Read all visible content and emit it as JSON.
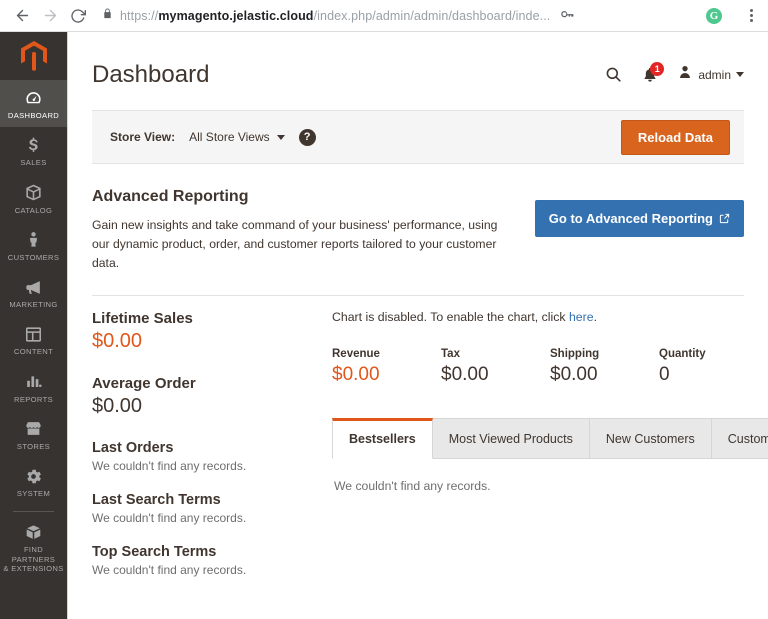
{
  "browser": {
    "back_icon": "arrow-left-icon",
    "forward_icon": "arrow-right-icon",
    "reload_icon": "reload-icon",
    "lock_icon": "lock-icon",
    "url_scheme": "https://",
    "url_domain": "mymagento.jelastic.cloud",
    "url_path": "/index.php/admin/admin/dashboard/inde...",
    "key_icon": "key-icon",
    "extension_icon": "extension-icon",
    "extension_glyph": "G",
    "menu_icon": "kebab-menu-icon"
  },
  "sidebar": {
    "logo": "magento-logo",
    "items": [
      {
        "label": "Dashboard",
        "icon": "gauge-icon",
        "active": true
      },
      {
        "label": "Sales",
        "icon": "dollar-icon",
        "active": false
      },
      {
        "label": "Catalog",
        "icon": "box-icon",
        "active": false
      },
      {
        "label": "Customers",
        "icon": "person-icon",
        "active": false
      },
      {
        "label": "Marketing",
        "icon": "megaphone-icon",
        "active": false
      },
      {
        "label": "Content",
        "icon": "layout-icon",
        "active": false
      },
      {
        "label": "Reports",
        "icon": "bar-chart-icon",
        "active": false
      },
      {
        "label": "Stores",
        "icon": "storefront-icon",
        "active": false
      },
      {
        "label": "System",
        "icon": "gear-icon",
        "active": false
      }
    ],
    "footer_item": {
      "label": "Find Partners\n& Extensions",
      "label_line1": "Find Partners",
      "label_line2": "& Extensions",
      "icon": "extension-block-icon"
    }
  },
  "header": {
    "title": "Dashboard",
    "search_icon": "search-icon",
    "notification_icon": "bell-icon",
    "notification_count": "1",
    "avatar_icon": "user-icon",
    "admin_label": "admin",
    "caret_icon": "chevron-down-icon"
  },
  "storeview": {
    "label": "Store View:",
    "selected": "All Store Views",
    "caret_icon": "chevron-down-icon",
    "help_icon": "question-mark-icon",
    "help_glyph": "?",
    "reload_label": "Reload Data"
  },
  "advanced_reporting": {
    "title": "Advanced Reporting",
    "description": "Gain new insights and take command of your business' performance, using our dynamic product, order, and customer reports tailored to your customer data.",
    "button_label": "Go to Advanced Reporting",
    "button_icon": "external-link-icon"
  },
  "stats": {
    "lifetime_sales": {
      "title": "Lifetime Sales",
      "value": "$0.00"
    },
    "average_order": {
      "title": "Average Order",
      "value": "$0.00"
    },
    "lists": [
      {
        "title": "Last Orders",
        "empty": "We couldn't find any records."
      },
      {
        "title": "Last Search Terms",
        "empty": "We couldn't find any records."
      },
      {
        "title": "Top Search Terms",
        "empty": "We couldn't find any records."
      }
    ]
  },
  "chart": {
    "note_prefix": "Chart is disabled. To enable the chart, click ",
    "note_link": "here",
    "note_suffix": ".",
    "totals": [
      {
        "label": "Revenue",
        "value": "$0.00",
        "accent": true
      },
      {
        "label": "Tax",
        "value": "$0.00",
        "accent": false
      },
      {
        "label": "Shipping",
        "value": "$0.00",
        "accent": false
      },
      {
        "label": "Quantity",
        "value": "0",
        "accent": false
      }
    ]
  },
  "tabs": {
    "items": [
      {
        "label": "Bestsellers",
        "active": true
      },
      {
        "label": "Most Viewed Products",
        "active": false
      },
      {
        "label": "New Customers",
        "active": false
      },
      {
        "label": "Customers",
        "active": false
      }
    ],
    "panel_empty": "We couldn't find any records."
  },
  "colors": {
    "brand_orange": "#e1571b",
    "button_orange": "#d9641e",
    "link_blue": "#3471b0",
    "sidebar_dark": "#373330",
    "badge_red": "#e22626"
  }
}
